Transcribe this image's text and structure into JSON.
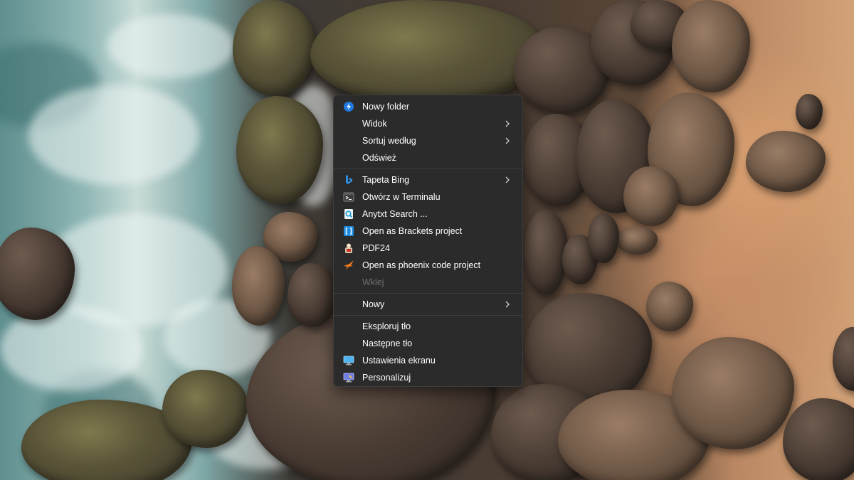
{
  "context_menu": {
    "groups": [
      {
        "items": [
          {
            "label": "Nowy folder",
            "icon": "new-folder-icon",
            "submenu": false
          },
          {
            "label": "Widok",
            "icon": null,
            "submenu": true
          },
          {
            "label": "Sortuj według",
            "icon": null,
            "submenu": true
          },
          {
            "label": "Odśwież",
            "icon": null,
            "submenu": false
          }
        ]
      },
      {
        "items": [
          {
            "label": "Tapeta Bing",
            "icon": "bing-icon",
            "submenu": true
          },
          {
            "label": "Otwórz w Terminalu",
            "icon": "terminal-icon",
            "submenu": false
          },
          {
            "label": "Anytxt Search ...",
            "icon": "anytxt-search-icon",
            "submenu": false
          },
          {
            "label": "Open as Brackets project",
            "icon": "brackets-icon",
            "submenu": false
          },
          {
            "label": "PDF24",
            "icon": "pdf24-icon",
            "submenu": false
          },
          {
            "label": "Open as phoenix code project",
            "icon": "phoenix-code-icon",
            "submenu": false
          },
          {
            "label": "Wklej",
            "icon": null,
            "submenu": false,
            "disabled": true
          }
        ]
      },
      {
        "items": [
          {
            "label": "Nowy",
            "icon": null,
            "submenu": true
          }
        ]
      },
      {
        "items": [
          {
            "label": "Eksploruj tło",
            "icon": null,
            "submenu": false
          },
          {
            "label": "Następne tło",
            "icon": null,
            "submenu": false
          },
          {
            "label": "Ustawienia ekranu",
            "icon": "display-settings-icon",
            "submenu": false
          },
          {
            "label": "Personalizuj",
            "icon": "personalize-icon",
            "submenu": false
          }
        ]
      }
    ]
  },
  "colors": {
    "menu_background": "#2b2b2b",
    "menu_text": "#ffffff",
    "disabled_text": "#6e6e6e",
    "separator": "#3f3f3f"
  }
}
